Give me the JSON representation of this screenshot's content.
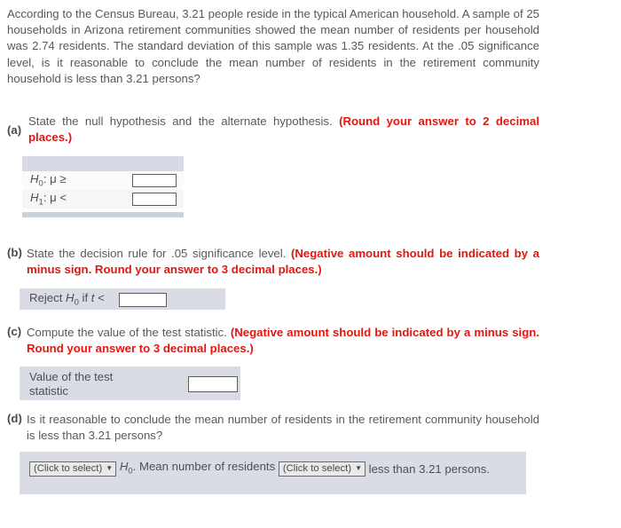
{
  "question": {
    "stem": "According to the Census Bureau, 3.21 people reside in the typical American household. A sample of 25 households in Arizona retirement communities showed the mean number of residents per household was 2.74 residents. The standard deviation of this sample was 1.35 residents. At the .05 significance level, is it reasonable to conclude the mean number of residents in the retirement community household is less than 3.21 persons?"
  },
  "parts": {
    "a": {
      "tag": "(a)",
      "prompt": "State the null hypothesis and the alternate hypothesis.",
      "instruction": "(Round your answer to 2 decimal places.)",
      "table": {
        "rows": [
          {
            "label_h": "H",
            "label_sub": "0",
            "label_rest": ": μ ≥",
            "value": ""
          },
          {
            "label_h": "H",
            "label_sub": "1",
            "label_rest": ": μ <",
            "value": ""
          }
        ]
      }
    },
    "b": {
      "tag": "(b)",
      "prompt": "State the decision rule for .05 significance level.",
      "instruction": "(Negative amount should be indicated by a minus sign. Round your answer to 3 decimal places.)",
      "row": {
        "label_pre": "Reject ",
        "label_h": "H",
        "label_sub": "0",
        "label_post": " if ",
        "label_t": "t",
        "label_end": " <",
        "value": ""
      }
    },
    "c": {
      "tag": "(c)",
      "prompt": "Compute the value of the test statistic.",
      "instruction": "(Negative amount should be indicated by a minus sign. Round your answer to 3 decimal places.)",
      "row": {
        "label": "Value of the test statistic",
        "value": ""
      }
    },
    "d": {
      "tag": "(d)",
      "prompt": "Is it reasonable to conclude the mean number of residents in the retirement community household is less than 3.21 persons?",
      "conclusion": {
        "select1_label": "(Click to select)",
        "mid_h": "H",
        "mid_sub": "0",
        "mid_text": ". Mean number of residents",
        "select2_label": "(Click to select)",
        "end_text": "less than 3.21 persons."
      }
    }
  },
  "colors": {
    "accent_red": "#e3170f",
    "table_header": "#d7dae4",
    "bar_background": "#d9dce5",
    "body_text": "#585858"
  }
}
